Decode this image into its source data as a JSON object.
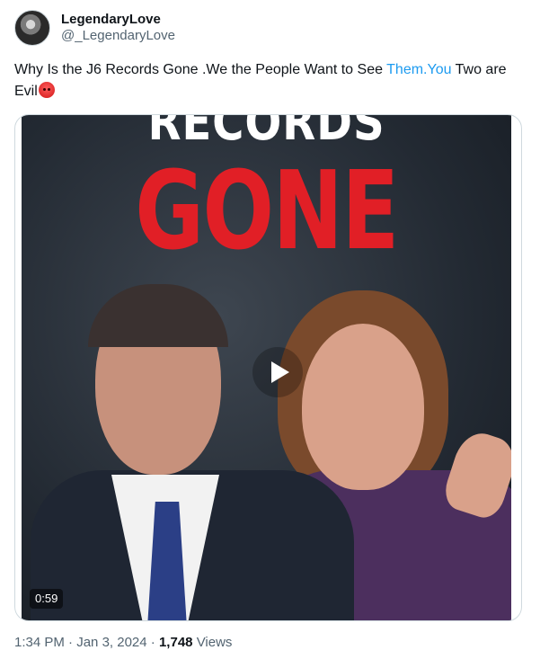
{
  "author": {
    "display_name": "LegendaryLove",
    "handle": "@_LegendaryLove"
  },
  "tweet": {
    "text_part1": "Why Is the J6 Records Gone .We the People Want to See ",
    "link_text": "Them.You",
    "text_part2": " Two are Evil",
    "emoji": "angry-face"
  },
  "media": {
    "headline_top": "RECORDS",
    "headline_main": "GONE",
    "duration": "0:59",
    "play_icon": "play-icon"
  },
  "meta": {
    "time": "1:34 PM",
    "date": "Jan 3, 2024",
    "views_count": "1,748",
    "views_label": "Views"
  },
  "colors": {
    "link": "#1d9bf0",
    "headline_red": "#e11f26",
    "secondary_text": "#536471"
  }
}
